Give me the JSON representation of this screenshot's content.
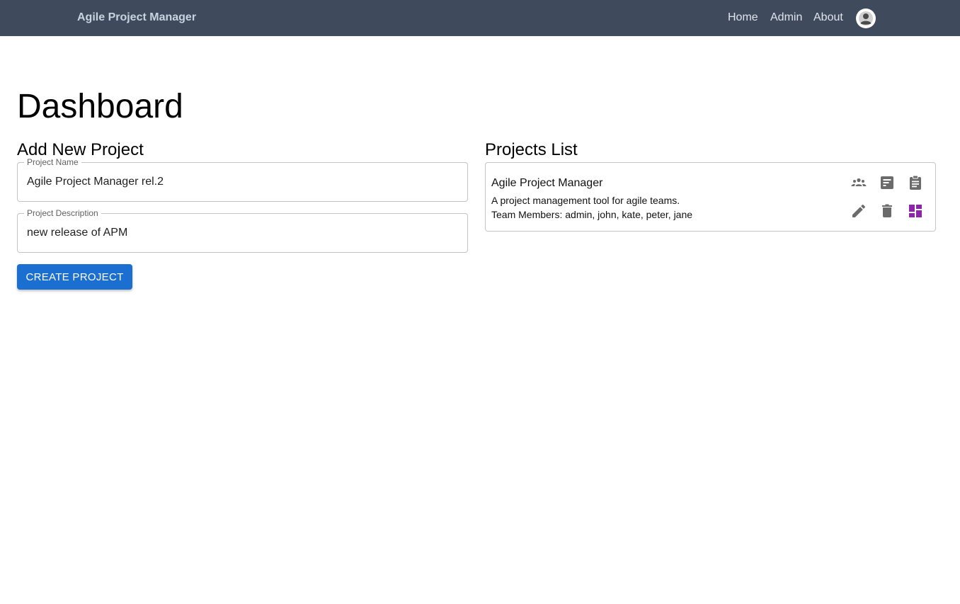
{
  "navbar": {
    "brand": "Agile Project Manager",
    "links": [
      "Home",
      "Admin",
      "About"
    ],
    "avatar_icon": "account-circle-icon"
  },
  "page": {
    "title": "Dashboard"
  },
  "add_project": {
    "title": "Add New Project",
    "name_label": "Project Name",
    "name_value": "Agile Project Manager rel.2",
    "description_label": "Project Description",
    "description_value": "new release of APM",
    "create_button": "CREATE PROJECT"
  },
  "projects_list": {
    "title": "Projects List",
    "projects": [
      {
        "name": "Agile Project Manager",
        "description": "A project management tool for agile teams.",
        "members": "Team Members: admin, john, kate, peter, jane",
        "actions": [
          "team-icon",
          "backlog-icon",
          "clipboard-icon",
          "edit-icon",
          "delete-icon",
          "dashboard-icon"
        ]
      }
    ]
  },
  "colors": {
    "navbar_bg": "#3f4b5c",
    "primary_button": "#1a6fd0",
    "icon_gray": "#6b6b6b",
    "dashboard_icon": "#8e24aa"
  }
}
